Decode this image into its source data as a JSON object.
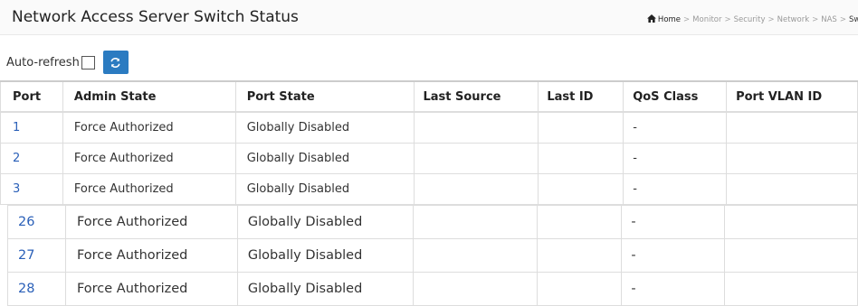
{
  "header": {
    "title": "Network Access Server Switch Status",
    "breadcrumb": [
      "Home",
      "Monitor",
      "Security",
      "Network",
      "NAS",
      "Swit"
    ]
  },
  "toolbar": {
    "auto_refresh_label": "Auto-refresh",
    "auto_refresh_checked": false,
    "refresh_icon": "refresh-icon"
  },
  "table": {
    "columns": [
      "Port",
      "Admin State",
      "Port State",
      "Last Source",
      "Last ID",
      "QoS Class",
      "Port VLAN ID"
    ],
    "rows_top": [
      {
        "port": "1",
        "admin_state": "Force Authorized",
        "port_state": "Globally Disabled",
        "last_source": "",
        "last_id": "",
        "qos_class": "-",
        "port_vlan_id": ""
      },
      {
        "port": "2",
        "admin_state": "Force Authorized",
        "port_state": "Globally Disabled",
        "last_source": "",
        "last_id": "",
        "qos_class": "-",
        "port_vlan_id": ""
      },
      {
        "port": "3",
        "admin_state": "Force Authorized",
        "port_state": "Globally Disabled",
        "last_source": "",
        "last_id": "",
        "qos_class": "-",
        "port_vlan_id": ""
      }
    ],
    "rows_bottom": [
      {
        "port": "26",
        "admin_state": "Force Authorized",
        "port_state": "Globally Disabled",
        "last_source": "",
        "last_id": "",
        "qos_class": "-",
        "port_vlan_id": ""
      },
      {
        "port": "27",
        "admin_state": "Force Authorized",
        "port_state": "Globally Disabled",
        "last_source": "",
        "last_id": "",
        "qos_class": "-",
        "port_vlan_id": ""
      },
      {
        "port": "28",
        "admin_state": "Force Authorized",
        "port_state": "Globally Disabled",
        "last_source": "",
        "last_id": "",
        "qos_class": "-",
        "port_vlan_id": ""
      }
    ]
  }
}
